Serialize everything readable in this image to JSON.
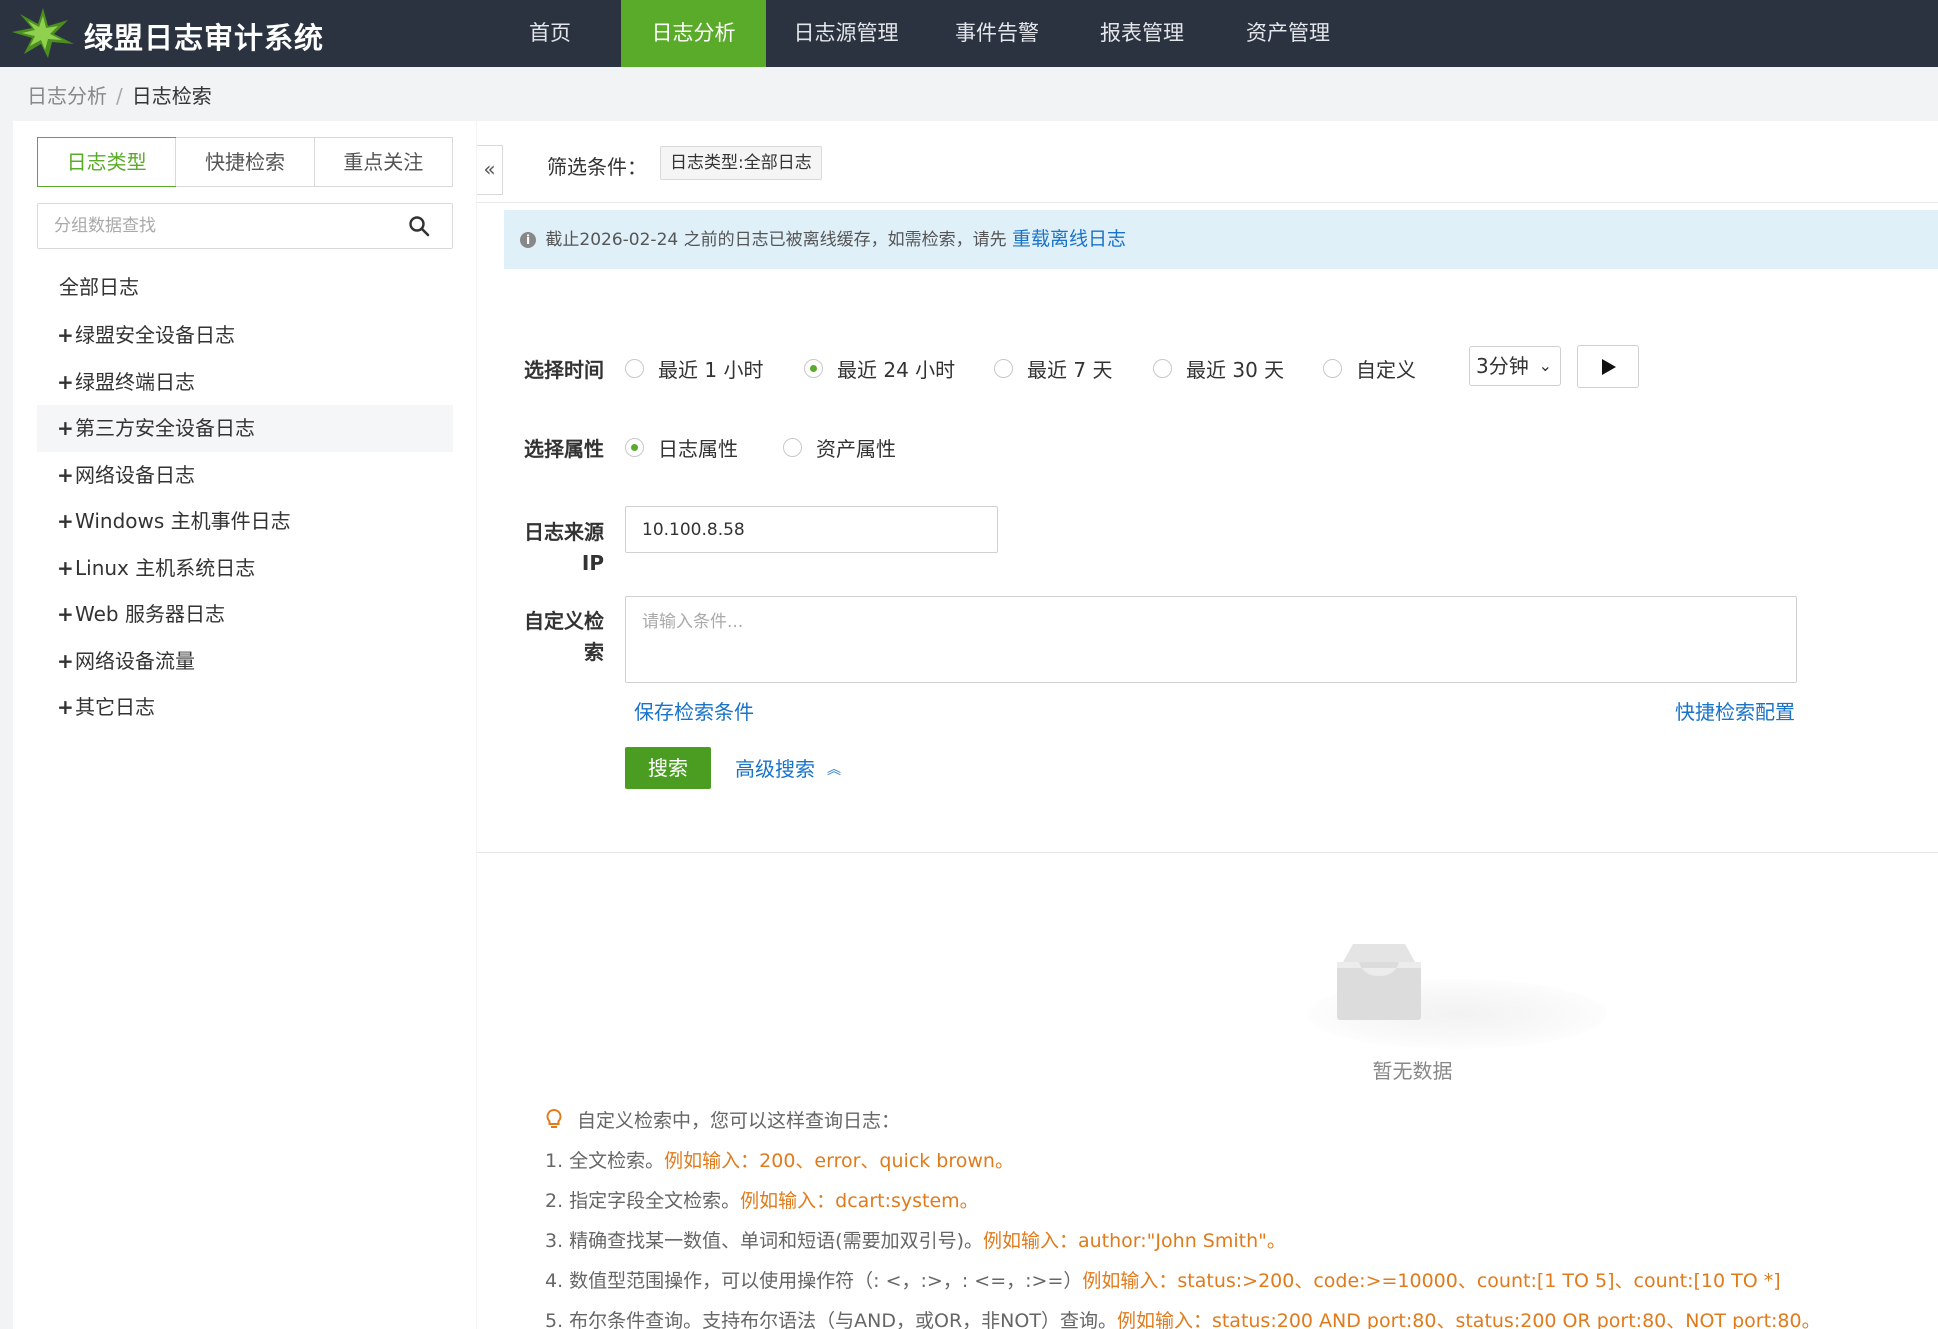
{
  "app": {
    "brand": "绿盟日志审计系统"
  },
  "nav": {
    "items": [
      "首页",
      "日志分析",
      "日志源管理",
      "事件告警",
      "报表管理",
      "资产管理"
    ],
    "active": "日志分析"
  },
  "breadcrumb": {
    "parent": "日志分析",
    "separator": "/",
    "current": "日志检索"
  },
  "sidebar": {
    "tabs": [
      "日志类型",
      "快捷检索",
      "重点关注"
    ],
    "search_placeholder": "分组数据查找",
    "root": "全部日志",
    "items": [
      "绿盟安全设备日志",
      "绿盟终端日志",
      "第三方安全设备日志",
      "网络设备日志",
      "Windows 主机事件日志",
      "Linux 主机系统日志",
      "Web 服务器日志",
      "网络设备流量",
      "其它日志"
    ],
    "expand_symbol": "+"
  },
  "main": {
    "collapse_symbol": "«",
    "filter_label": "筛选条件：",
    "filter_tag": "日志类型:全部日志",
    "alert": {
      "text": "截止2026-02-24 之前的日志已被离线缓存，如需检索，请先",
      "link": "重载离线日志"
    },
    "time": {
      "label": "选择时间",
      "options": [
        "最近 1 小时",
        "最近 24 小时",
        "最近 7 天",
        "最近 30 天",
        "自定义"
      ],
      "selected": "最近 24 小时",
      "interval": "3分钟"
    },
    "attr": {
      "label": "选择属性",
      "options": [
        "日志属性",
        "资产属性"
      ],
      "selected": "日志属性"
    },
    "source_ip": {
      "label_line1": "日志来源",
      "label_line2": "IP",
      "value": "10.100.8.58"
    },
    "custom": {
      "label_line1": "自定义检",
      "label_line2": "索",
      "placeholder": "请输入条件..."
    },
    "save_link": "保存检索条件",
    "quick_config_link": "快捷检索配置",
    "search_button": "搜索",
    "advanced_link": "高级搜索",
    "empty_text": "暂无数据"
  },
  "tips": {
    "head": "自定义检索中，您可以这样查询日志：",
    "rows": [
      {
        "text": "1. 全文检索。",
        "example": "例如输入：200、error、quick brown。"
      },
      {
        "text": "2. 指定字段全文检索。",
        "example": "例如输入：dcart:system。"
      },
      {
        "text": "3. 精确查找某一数值、单词和短语(需要加双引号)。",
        "example": "例如输入：author:\"John Smith\"。"
      },
      {
        "text": "4. 数值型范围操作，可以使用操作符（: <，:>，: <=，:>=）",
        "example": "例如输入：status:>200、code:>=10000、count:[1 TO 5]、count:[10 TO *]"
      },
      {
        "text": "5. 布尔条件查询。支持布尔语法（与AND，或OR，非NOT）查询。",
        "example": "例如输入：status:200 AND port:80、status:200 OR port:80、NOT port:80。"
      }
    ]
  },
  "colors": {
    "accent": "#5bab2a",
    "nav_bg": "#2b3340",
    "link": "#1a73c8",
    "example": "#e07b1c",
    "alert_bg": "#dff0f8"
  },
  "icons": [
    "logo-icon",
    "search-icon",
    "info-icon",
    "play-icon",
    "chevron-down-icon",
    "chevron-up-icon",
    "bulb-icon",
    "empty-inbox-icon"
  ]
}
